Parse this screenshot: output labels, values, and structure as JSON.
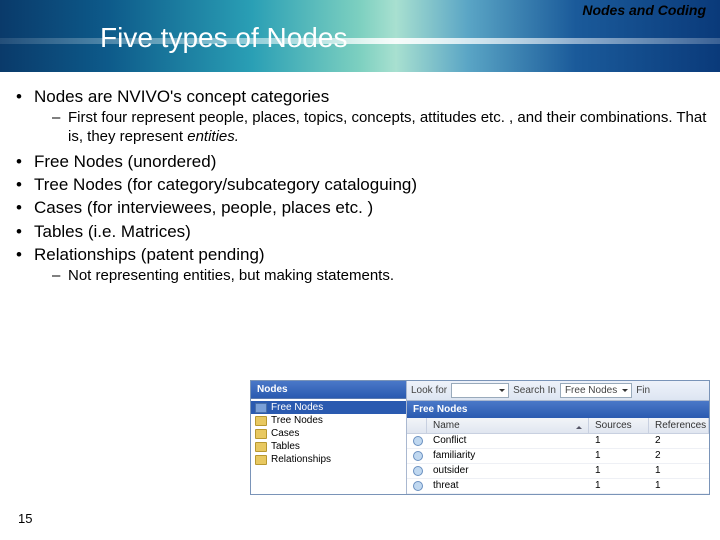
{
  "header": {
    "category": "Nodes and Coding",
    "title": "Five types of Nodes"
  },
  "bullets": {
    "b1": "Nodes are NVIVO's concept categories",
    "b1_sub": "First four represent people, places, topics, concepts, attitudes etc. , and their combinations. That is, they represent ",
    "b1_sub_em": "entities.",
    "b2": "Free Nodes (unordered)",
    "b3": "Tree Nodes (for category/subcategory cataloguing)",
    "b4": "Cases (for interviewees, people, places etc. )",
    "b5": "Tables (i.e. Matrices)",
    "b6": "Relationships (patent pending)",
    "b6_sub": "Not representing entities, but making statements."
  },
  "screenshot": {
    "left_head": "Nodes",
    "tree": [
      "Free Nodes",
      "Tree Nodes",
      "Cases",
      "Tables",
      "Relationships"
    ],
    "toolbar": {
      "look": "Look for",
      "search": "Search In",
      "dd": "Free Nodes",
      "fin": "Fin"
    },
    "right_head": "Free Nodes",
    "cols": {
      "name": "Name",
      "sources": "Sources",
      "refs": "References"
    },
    "rows": [
      {
        "name": "Conflict",
        "sources": "1",
        "refs": "2"
      },
      {
        "name": "familiarity",
        "sources": "1",
        "refs": "2"
      },
      {
        "name": "outsider",
        "sources": "1",
        "refs": "1"
      },
      {
        "name": "threat",
        "sources": "1",
        "refs": "1"
      }
    ]
  },
  "slide_num": "15"
}
